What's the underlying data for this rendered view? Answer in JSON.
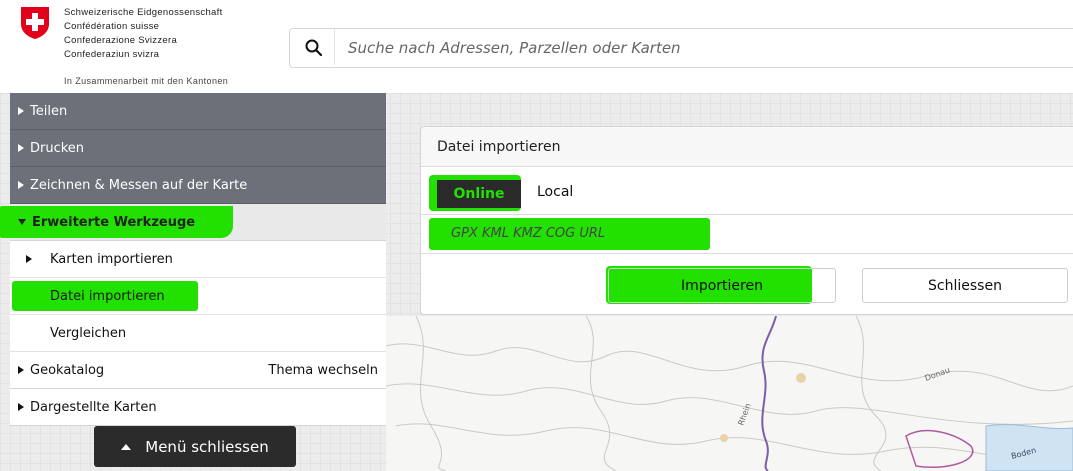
{
  "header": {
    "confederation_lines": [
      "Schweizerische Eidgenossenschaft",
      "Confédération suisse",
      "Confederazione Svizzera",
      "Confederaziun svizra"
    ],
    "cooperation": "In Zusammenarbeit mit den Kantonen",
    "search_placeholder": "Suche nach Adressen, Parzellen oder Karten"
  },
  "sidebar": {
    "items": [
      {
        "label": "Teilen"
      },
      {
        "label": "Drucken"
      },
      {
        "label": "Zeichnen & Messen auf der Karte"
      },
      {
        "label": "Erweiterte Werkzeuge"
      }
    ],
    "sub_items": [
      {
        "label": "Karten importieren"
      },
      {
        "label": "Datei importieren"
      },
      {
        "label": "Vergleichen"
      }
    ],
    "geokatalog": "Geokatalog",
    "thema_wechseln": "Thema wechseln",
    "dargestellte_karten": "Dargestellte Karten",
    "close_menu": "Menü schliessen"
  },
  "import_panel": {
    "title": "Datei importieren",
    "tab_online": "Online",
    "tab_local": "Local",
    "url_placeholder": "GPX KML KMZ COG URL",
    "import_button": "Importieren",
    "close_button": "Schliessen"
  },
  "map": {
    "labels": [
      "Rhein",
      "Donau",
      "Boden"
    ]
  },
  "colors": {
    "highlight": "#22e000",
    "menu_dark": "#6b7079",
    "swiss_red": "#e3001b"
  }
}
